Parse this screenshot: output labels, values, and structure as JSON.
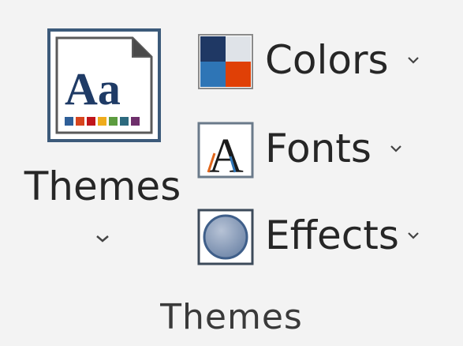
{
  "ribbon_group": {
    "caption": "Themes",
    "themes_button": {
      "label": "Themes",
      "icon": "themes-gallery-icon",
      "icon_text": "Aa",
      "swatch_colors": [
        "#2f5f98",
        "#d7451e",
        "#c0151b",
        "#efac1c",
        "#5c9c3f",
        "#2d6a7e",
        "#6e2f6b"
      ]
    },
    "colors_button": {
      "label": "Colors",
      "icon": "theme-colors-icon",
      "quadrant_colors": [
        "#1f3864",
        "#dfe3e8",
        "#2e75b6",
        "#e04006"
      ]
    },
    "fonts_button": {
      "label": "Fonts",
      "icon": "theme-fonts-icon",
      "icon_text": "A"
    },
    "effects_button": {
      "label": "Effects",
      "icon": "theme-effects-icon"
    }
  }
}
